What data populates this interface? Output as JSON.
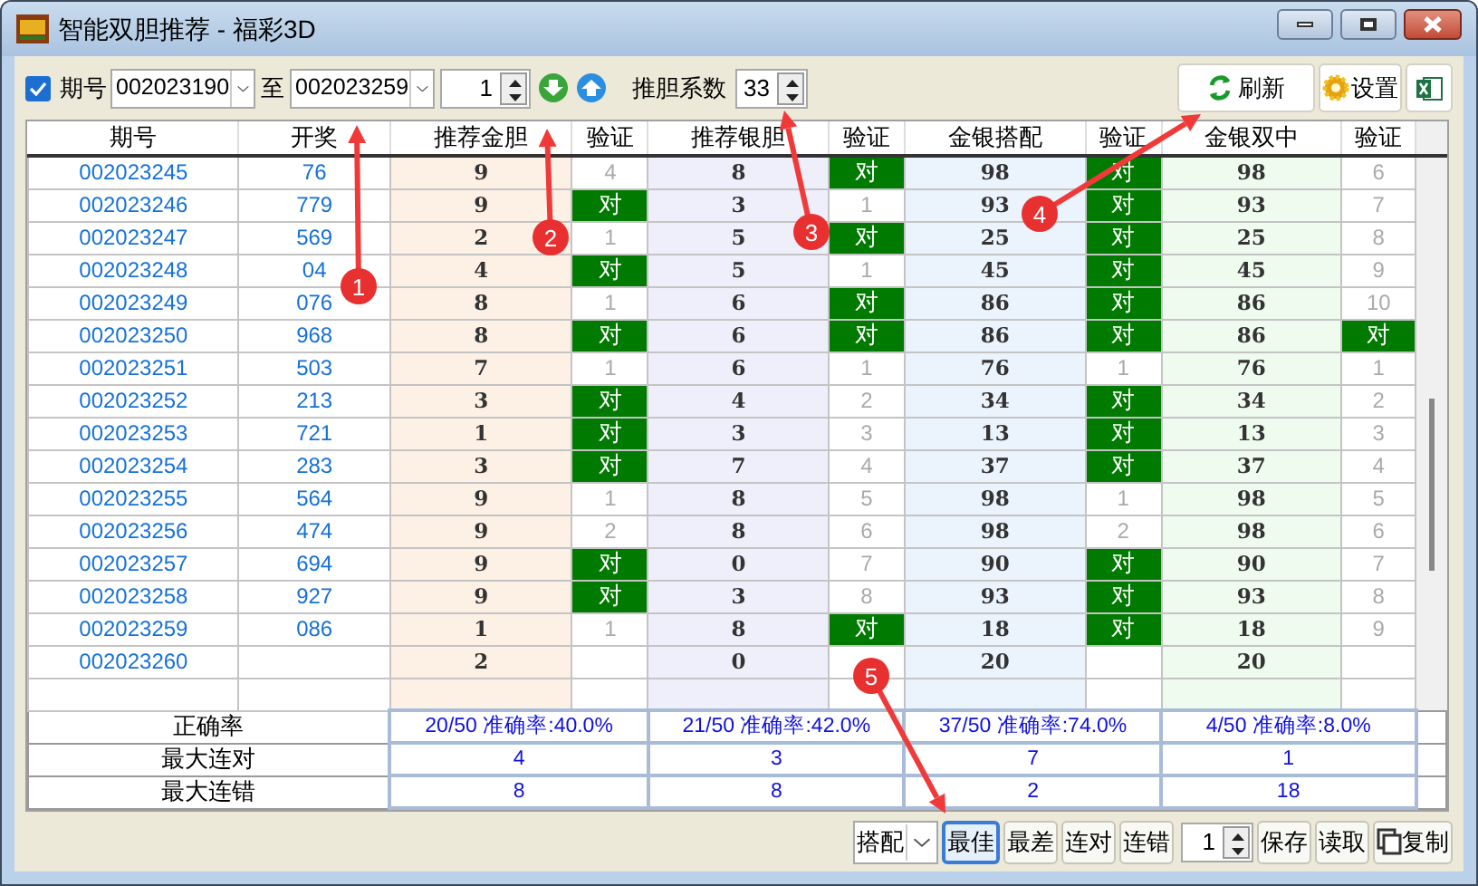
{
  "window": {
    "title": "智能双胆推荐 - 福彩3D"
  },
  "toolbar": {
    "period": {
      "label": "期号",
      "checked": true
    },
    "from": "002023190",
    "to_label": "至",
    "to": "002023259",
    "count": "1",
    "coef_label": "推胆系数",
    "coef": "33",
    "refresh": "刷新",
    "settings": "设置"
  },
  "table": {
    "columns": [
      "期号",
      "开奖",
      "推荐金胆",
      "验证",
      "推荐银胆",
      "验证",
      "金银搭配",
      "验证",
      "金银双中",
      "验证"
    ],
    "rows": [
      {
        "cells": [
          {
            "text": "002023245"
          },
          {
            "text": "76"
          },
          {
            "text": "9"
          },
          {
            "text": "4",
            "hit": false
          },
          {
            "text": "8"
          },
          {
            "text": "对",
            "hit": true
          },
          {
            "text": "98"
          },
          {
            "text": "对",
            "hit": true
          },
          {
            "text": "98"
          },
          {
            "text": "6",
            "hit": false
          }
        ]
      },
      {
        "cells": [
          {
            "text": "002023246"
          },
          {
            "text": "779"
          },
          {
            "text": "9"
          },
          {
            "text": "对",
            "hit": true
          },
          {
            "text": "3"
          },
          {
            "text": "1",
            "hit": false
          },
          {
            "text": "93"
          },
          {
            "text": "对",
            "hit": true
          },
          {
            "text": "93"
          },
          {
            "text": "7",
            "hit": false
          }
        ]
      },
      {
        "cells": [
          {
            "text": "002023247"
          },
          {
            "text": "569"
          },
          {
            "text": "2"
          },
          {
            "text": "1",
            "hit": false
          },
          {
            "text": "5"
          },
          {
            "text": "对",
            "hit": true
          },
          {
            "text": "25"
          },
          {
            "text": "对",
            "hit": true
          },
          {
            "text": "25"
          },
          {
            "text": "8",
            "hit": false
          }
        ]
      },
      {
        "cells": [
          {
            "text": "002023248"
          },
          {
            "text": "04"
          },
          {
            "text": "4"
          },
          {
            "text": "对",
            "hit": true
          },
          {
            "text": "5"
          },
          {
            "text": "1",
            "hit": false
          },
          {
            "text": "45"
          },
          {
            "text": "对",
            "hit": true
          },
          {
            "text": "45"
          },
          {
            "text": "9",
            "hit": false
          }
        ]
      },
      {
        "cells": [
          {
            "text": "002023249"
          },
          {
            "text": "076"
          },
          {
            "text": "8"
          },
          {
            "text": "1",
            "hit": false
          },
          {
            "text": "6"
          },
          {
            "text": "对",
            "hit": true
          },
          {
            "text": "86"
          },
          {
            "text": "对",
            "hit": true
          },
          {
            "text": "86"
          },
          {
            "text": "10",
            "hit": false
          }
        ]
      },
      {
        "cells": [
          {
            "text": "002023250"
          },
          {
            "text": "968"
          },
          {
            "text": "8"
          },
          {
            "text": "对",
            "hit": true
          },
          {
            "text": "6"
          },
          {
            "text": "对",
            "hit": true
          },
          {
            "text": "86"
          },
          {
            "text": "对",
            "hit": true
          },
          {
            "text": "86"
          },
          {
            "text": "对",
            "hit": true
          }
        ]
      },
      {
        "cells": [
          {
            "text": "002023251"
          },
          {
            "text": "503"
          },
          {
            "text": "7"
          },
          {
            "text": "1",
            "hit": false
          },
          {
            "text": "6"
          },
          {
            "text": "1",
            "hit": false
          },
          {
            "text": "76"
          },
          {
            "text": "1",
            "hit": false
          },
          {
            "text": "76"
          },
          {
            "text": "1",
            "hit": false
          }
        ]
      },
      {
        "cells": [
          {
            "text": "002023252"
          },
          {
            "text": "213"
          },
          {
            "text": "3"
          },
          {
            "text": "对",
            "hit": true
          },
          {
            "text": "4"
          },
          {
            "text": "2",
            "hit": false
          },
          {
            "text": "34"
          },
          {
            "text": "对",
            "hit": true
          },
          {
            "text": "34"
          },
          {
            "text": "2",
            "hit": false
          }
        ]
      },
      {
        "cells": [
          {
            "text": "002023253"
          },
          {
            "text": "721"
          },
          {
            "text": "1"
          },
          {
            "text": "对",
            "hit": true
          },
          {
            "text": "3"
          },
          {
            "text": "3",
            "hit": false
          },
          {
            "text": "13"
          },
          {
            "text": "对",
            "hit": true
          },
          {
            "text": "13"
          },
          {
            "text": "3",
            "hit": false
          }
        ]
      },
      {
        "cells": [
          {
            "text": "002023254"
          },
          {
            "text": "283"
          },
          {
            "text": "3"
          },
          {
            "text": "对",
            "hit": true
          },
          {
            "text": "7"
          },
          {
            "text": "4",
            "hit": false
          },
          {
            "text": "37"
          },
          {
            "text": "对",
            "hit": true
          },
          {
            "text": "37"
          },
          {
            "text": "4",
            "hit": false
          }
        ]
      },
      {
        "cells": [
          {
            "text": "002023255"
          },
          {
            "text": "564"
          },
          {
            "text": "9"
          },
          {
            "text": "1",
            "hit": false
          },
          {
            "text": "8"
          },
          {
            "text": "5",
            "hit": false
          },
          {
            "text": "98"
          },
          {
            "text": "1",
            "hit": false
          },
          {
            "text": "98"
          },
          {
            "text": "5",
            "hit": false
          }
        ]
      },
      {
        "cells": [
          {
            "text": "002023256"
          },
          {
            "text": "474"
          },
          {
            "text": "9"
          },
          {
            "text": "2",
            "hit": false
          },
          {
            "text": "8"
          },
          {
            "text": "6",
            "hit": false
          },
          {
            "text": "98"
          },
          {
            "text": "2",
            "hit": false
          },
          {
            "text": "98"
          },
          {
            "text": "6",
            "hit": false
          }
        ]
      },
      {
        "cells": [
          {
            "text": "002023257"
          },
          {
            "text": "694"
          },
          {
            "text": "9"
          },
          {
            "text": "对",
            "hit": true
          },
          {
            "text": "0"
          },
          {
            "text": "7",
            "hit": false
          },
          {
            "text": "90"
          },
          {
            "text": "对",
            "hit": true
          },
          {
            "text": "90"
          },
          {
            "text": "7",
            "hit": false
          }
        ]
      },
      {
        "cells": [
          {
            "text": "002023258"
          },
          {
            "text": "927"
          },
          {
            "text": "9"
          },
          {
            "text": "对",
            "hit": true
          },
          {
            "text": "3"
          },
          {
            "text": "8",
            "hit": false
          },
          {
            "text": "93"
          },
          {
            "text": "对",
            "hit": true
          },
          {
            "text": "93"
          },
          {
            "text": "8",
            "hit": false
          }
        ]
      },
      {
        "cells": [
          {
            "text": "002023259"
          },
          {
            "text": "086"
          },
          {
            "text": "1"
          },
          {
            "text": "1",
            "hit": false
          },
          {
            "text": "8"
          },
          {
            "text": "对",
            "hit": true
          },
          {
            "text": "18"
          },
          {
            "text": "对",
            "hit": true
          },
          {
            "text": "18"
          },
          {
            "text": "9",
            "hit": false
          }
        ]
      },
      {
        "cells": [
          {
            "text": "002023260"
          },
          {
            "text": ""
          },
          {
            "text": "2"
          },
          {
            "text": ""
          },
          {
            "text": "0"
          },
          {
            "text": ""
          },
          {
            "text": "20"
          },
          {
            "text": ""
          },
          {
            "text": "20"
          },
          {
            "text": ""
          }
        ]
      }
    ],
    "summary": [
      {
        "label": "正确率",
        "values": [
          "20/50 准确率:40.0%",
          "21/50 准确率:42.0%",
          "37/50 准确率:74.0%",
          "4/50 准确率:8.0%"
        ]
      },
      {
        "label": "最大连对",
        "values": [
          "4",
          "3",
          "7",
          "1"
        ]
      },
      {
        "label": "最大连错",
        "values": [
          "8",
          "8",
          "2",
          "18"
        ]
      }
    ]
  },
  "bottom": {
    "mode": "搭配",
    "buttons": [
      {
        "label": "最佳",
        "selected": true
      },
      {
        "label": "最差",
        "selected": false
      },
      {
        "label": "连对",
        "selected": false
      },
      {
        "label": "连错",
        "selected": false
      }
    ],
    "count": "1",
    "actions": [
      "保存",
      "读取",
      "复制"
    ]
  },
  "annotations": [
    {
      "label": "1"
    },
    {
      "label": "2"
    },
    {
      "label": "3"
    },
    {
      "label": "4"
    },
    {
      "label": "5"
    }
  ]
}
